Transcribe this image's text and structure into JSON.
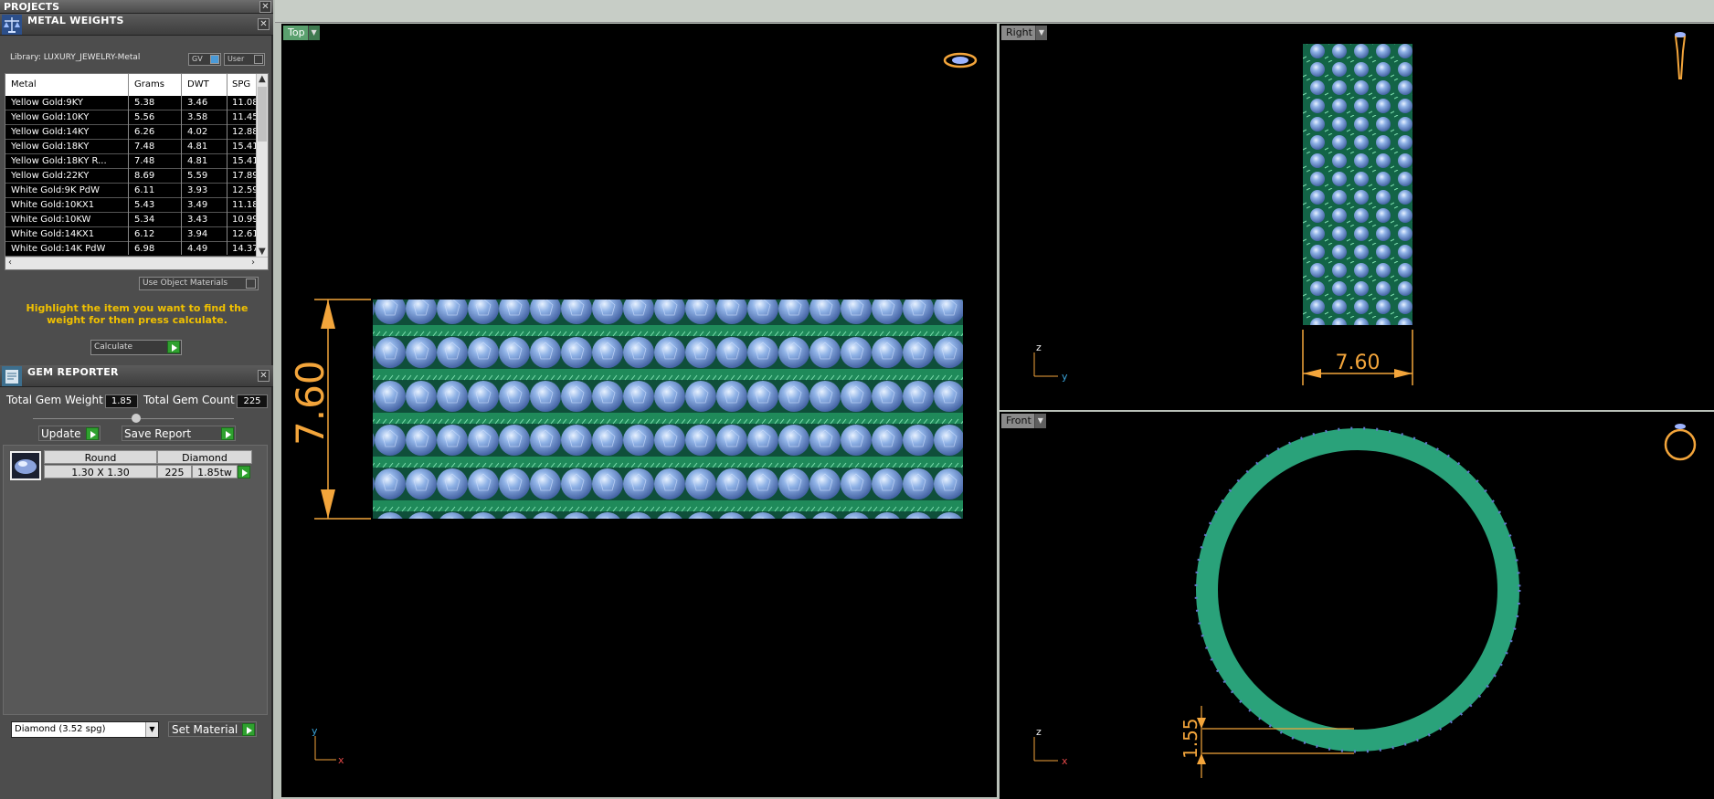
{
  "projects": {
    "title": "PROJECTS"
  },
  "metal_weights": {
    "title": "METAL WEIGHTS",
    "library": "Library: LUXURY_JEWELRY-Metal",
    "toggle_gv": "GV",
    "toggle_user": "User",
    "columns": [
      "Metal",
      "Grams",
      "DWT",
      "SPG"
    ],
    "rows": [
      [
        "Yellow Gold:9KY",
        "5.38",
        "3.46",
        "11.08"
      ],
      [
        "Yellow Gold:10KY",
        "5.56",
        "3.58",
        "11.45"
      ],
      [
        "Yellow Gold:14KY",
        "6.26",
        "4.02",
        "12.88"
      ],
      [
        "Yellow Gold:18KY",
        "7.48",
        "4.81",
        "15.41"
      ],
      [
        "Yellow Gold:18KY R...",
        "7.48",
        "4.81",
        "15.41"
      ],
      [
        "Yellow Gold:22KY",
        "8.69",
        "5.59",
        "17.89"
      ],
      [
        "White Gold:9K PdW",
        "6.11",
        "3.93",
        "12.59"
      ],
      [
        "White Gold:10KX1",
        "5.43",
        "3.49",
        "11.18"
      ],
      [
        "White Gold:10KW",
        "5.34",
        "3.43",
        "10.99"
      ],
      [
        "White Gold:14KX1",
        "6.12",
        "3.94",
        "12.61"
      ],
      [
        "White Gold:14K PdW",
        "6.98",
        "4.49",
        "14.37"
      ]
    ],
    "use_object_materials": "Use Object Materials",
    "hint": "Highlight the item you want to find the weight for then press calculate.",
    "calculate": "Calculate"
  },
  "gem_reporter": {
    "title": "GEM REPORTER",
    "total_weight_label": "Total Gem Weight",
    "total_weight": "1.85",
    "total_count_label": "Total Gem Count",
    "total_count": "225",
    "update": "Update",
    "save_report": "Save Report",
    "gem": {
      "shape": "Round",
      "material": "Diamond",
      "size": "1.30 X 1.30",
      "count": "225",
      "weight": "1.85tw"
    },
    "material_select": "Diamond    (3.52 spg)",
    "set_material": "Set Material"
  },
  "viewports": {
    "top": {
      "label": "Top",
      "dimension": "7.60",
      "axis_v": "y",
      "axis_h": "x"
    },
    "right": {
      "label": "Right",
      "dimension": "7.60",
      "axis_v": "z",
      "axis_h": "y"
    },
    "front": {
      "label": "Front",
      "dimension": "1.55",
      "axis_v": "z",
      "axis_h": "x"
    }
  },
  "colors": {
    "accent_yellow": "#f0c000",
    "dimension_orange": "#f3a53b",
    "metal_green": "#1f8a5a",
    "gem_blue": "#7fa6dc"
  }
}
